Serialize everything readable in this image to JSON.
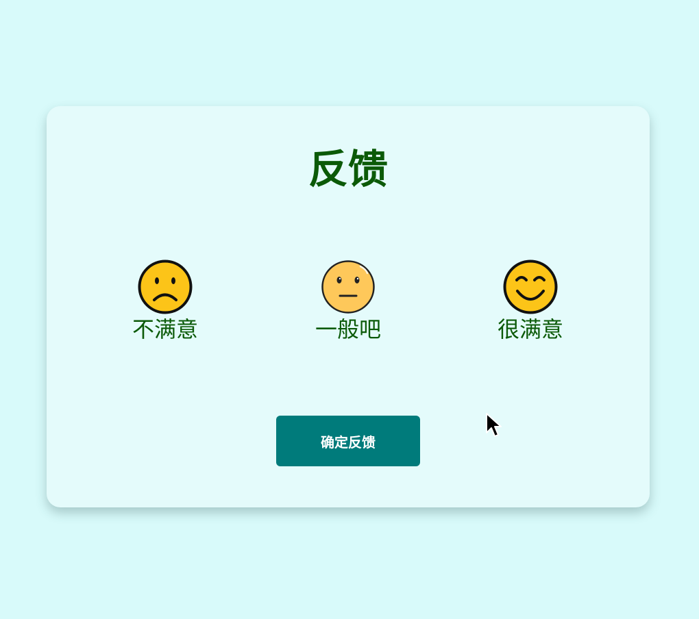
{
  "card": {
    "title": "反馈"
  },
  "options": [
    {
      "label": "不满意",
      "icon": "sad-face-icon"
    },
    {
      "label": "一般吧",
      "icon": "neutral-face-icon"
    },
    {
      "label": "很满意",
      "icon": "happy-face-icon"
    }
  ],
  "confirm_button": {
    "label": "确定反馈"
  },
  "colors": {
    "page_background": "#d8fafa",
    "card_background": "#e4fbfb",
    "title_text": "#0b5a08",
    "button_background": "#007b7b",
    "button_text": "#ffffff",
    "face_yellow": "#fcc418",
    "face_neutral": "#fec85a"
  }
}
